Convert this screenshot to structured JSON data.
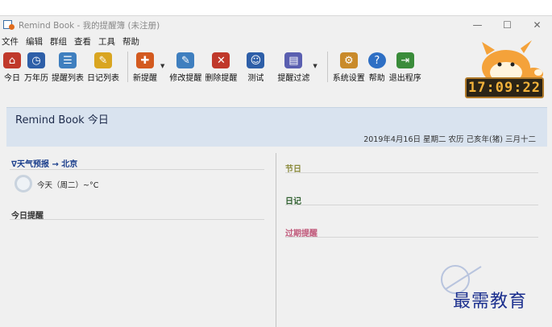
{
  "window": {
    "title": "Remind Book - 我的提醒簿 (未注册)",
    "controls": [
      "—",
      "☐",
      "✕"
    ]
  },
  "menu": [
    "文件",
    "编辑",
    "群组",
    "查看",
    "工具",
    "帮助"
  ],
  "toolbar": {
    "group1": [
      {
        "label": "今日",
        "icon": "home-icon",
        "color": "#c0392b"
      },
      {
        "label": "万年历",
        "icon": "calendar-clock-icon",
        "color": "#2e5fa8"
      },
      {
        "label": "提醒列表",
        "icon": "reminder-list-icon",
        "color": "#3f7fbf"
      },
      {
        "label": "日记列表",
        "icon": "diary-list-icon",
        "color": "#d9a520"
      }
    ],
    "group2": [
      {
        "label": "新提醒",
        "icon": "new-reminder-icon",
        "color": "#d35a1f",
        "dropdown": true
      },
      {
        "label": "修改提醒",
        "icon": "edit-reminder-icon",
        "color": "#3f7fbf"
      },
      {
        "label": "删除提醒",
        "icon": "delete-reminder-icon",
        "color": "#c0392b"
      },
      {
        "label": "测试",
        "icon": "test-users-icon",
        "color": "#2e5fa8"
      },
      {
        "label": "提醒过滤",
        "icon": "filter-icon",
        "color": "#5a5fb0",
        "dropdown": true
      }
    ],
    "group3": [
      {
        "label": "系统设置",
        "icon": "wrench-icon",
        "color": "#c98a2a"
      },
      {
        "label": "帮助",
        "icon": "help-icon",
        "color": "#2e6fc4"
      },
      {
        "label": "退出程序",
        "icon": "exit-icon",
        "color": "#3a8c3a"
      }
    ]
  },
  "clock": "17:09:22",
  "banner": {
    "title": "Remind Book 今日",
    "date": "2019年4月16日 星期二      农历 己亥年(猪) 三月十二"
  },
  "left": {
    "weather_heading": "∇天气预报 → 北京",
    "weather_line": "今天（周二）~°C",
    "today_heading": "今日提醒"
  },
  "right": {
    "festival": "节日",
    "diary": "日记",
    "overdue": "过期提醒"
  },
  "colors": {
    "festival": "#8a8a3a",
    "diary": "#2f5f2f",
    "overdue": "#c0587a",
    "accent": "#1a3e8c"
  },
  "watermark": "最需教育"
}
